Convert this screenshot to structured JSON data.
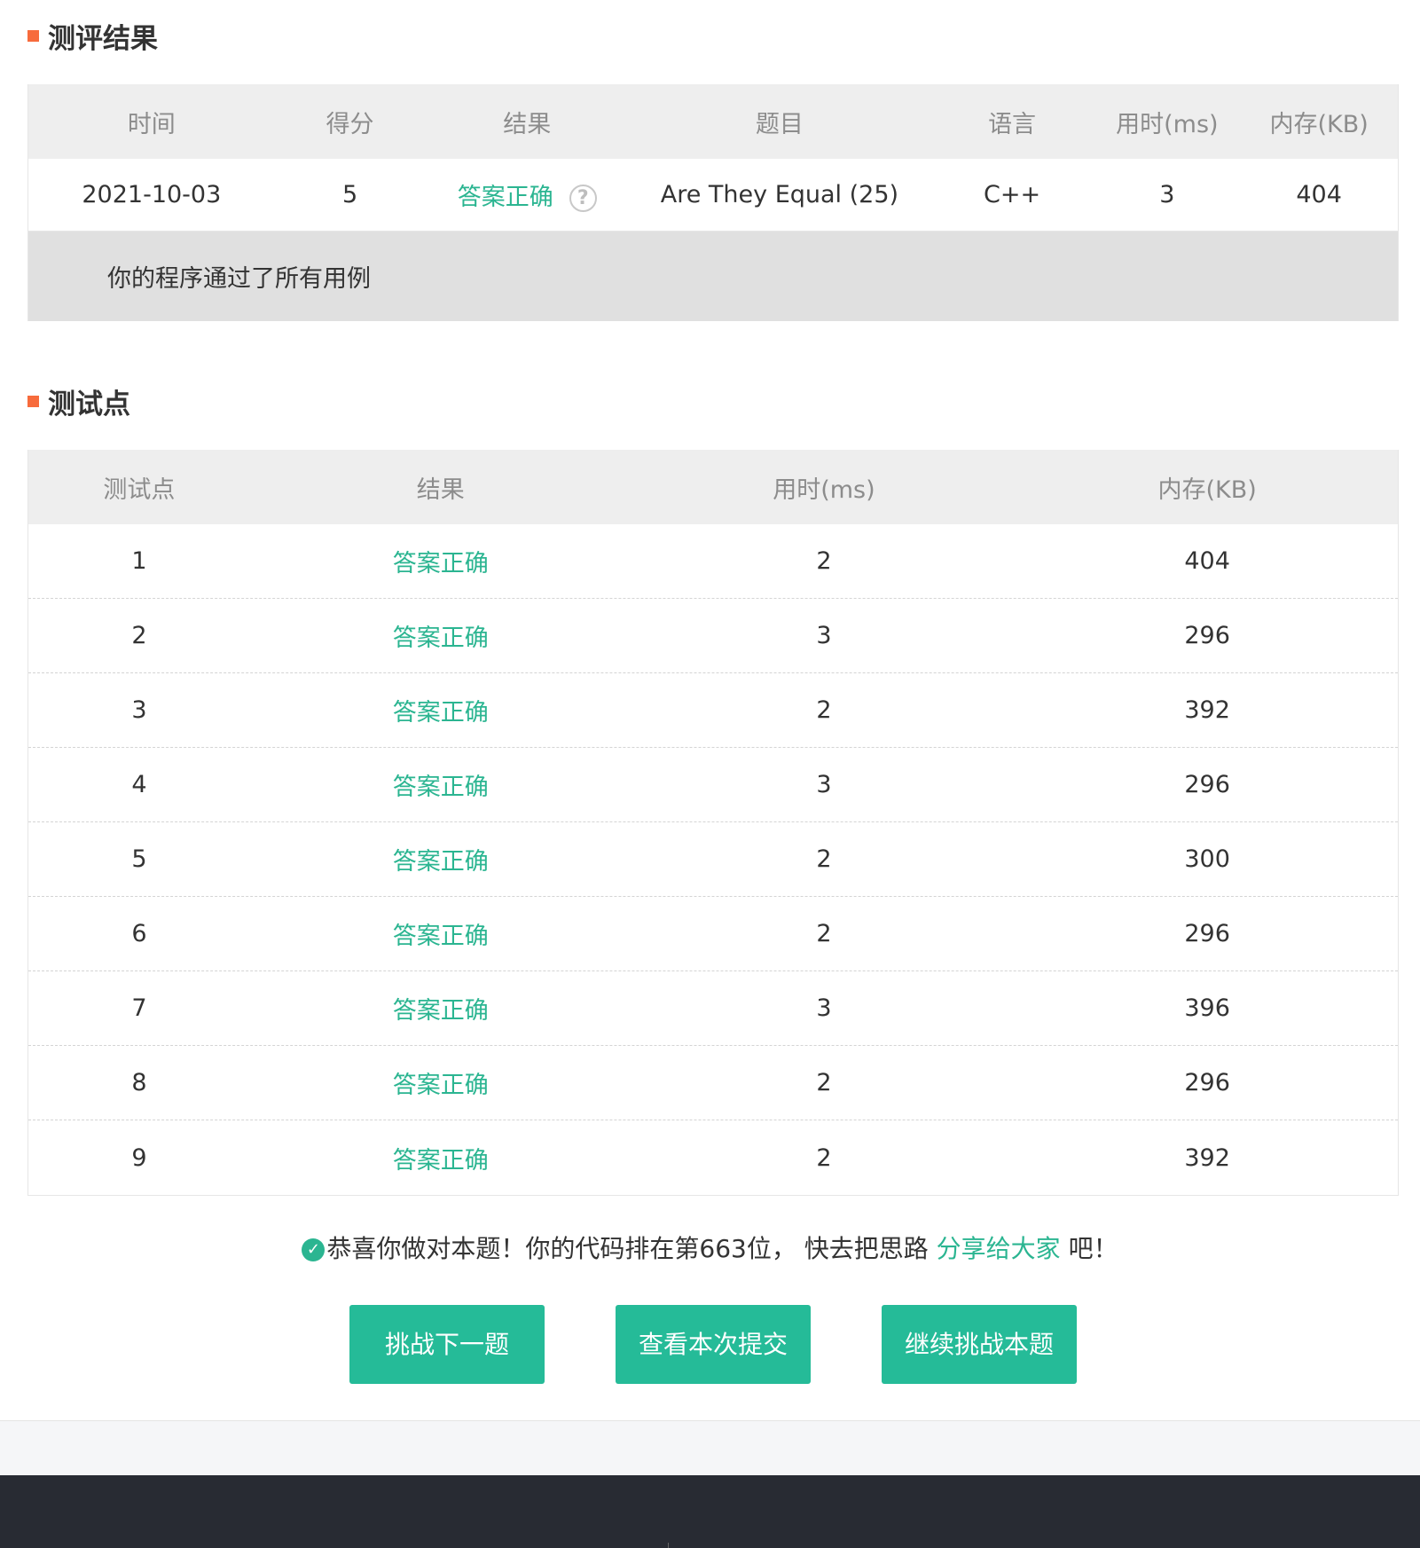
{
  "result_section": {
    "title": "测评结果",
    "headers": [
      "时间",
      "得分",
      "结果",
      "题目",
      "语言",
      "用时(ms)",
      "内存(KB)"
    ],
    "row": {
      "time": "2021-10-03",
      "score": "5",
      "result": "答案正确",
      "problem": "Are They Equal (25)",
      "language": "C++",
      "time_ms": "3",
      "memory_kb": "404"
    },
    "message": "你的程序通过了所有用例"
  },
  "testpoint_section": {
    "title": "测试点",
    "headers": [
      "测试点",
      "结果",
      "用时(ms)",
      "内存(KB)"
    ],
    "rows": [
      {
        "id": "1",
        "result": "答案正确",
        "time_ms": "2",
        "memory_kb": "404"
      },
      {
        "id": "2",
        "result": "答案正确",
        "time_ms": "3",
        "memory_kb": "296"
      },
      {
        "id": "3",
        "result": "答案正确",
        "time_ms": "2",
        "memory_kb": "392"
      },
      {
        "id": "4",
        "result": "答案正确",
        "time_ms": "3",
        "memory_kb": "296"
      },
      {
        "id": "5",
        "result": "答案正确",
        "time_ms": "2",
        "memory_kb": "300"
      },
      {
        "id": "6",
        "result": "答案正确",
        "time_ms": "2",
        "memory_kb": "296"
      },
      {
        "id": "7",
        "result": "答案正确",
        "time_ms": "3",
        "memory_kb": "396"
      },
      {
        "id": "8",
        "result": "答案正确",
        "time_ms": "2",
        "memory_kb": "296"
      },
      {
        "id": "9",
        "result": "答案正确",
        "time_ms": "2",
        "memory_kb": "392"
      }
    ]
  },
  "congrats": {
    "text": "恭喜你做对本题！你的代码排在第663位， 快去把思路 ",
    "link": "分享给大家",
    "suffix": " 吧！"
  },
  "buttons": {
    "next": "挑战下一题",
    "view_submission": "查看本次提交",
    "retry": "继续挑战本题"
  },
  "icons": {
    "help": "question-mark-circle",
    "check": "check-circle"
  },
  "colors": {
    "accent": "#25bb98",
    "success_text": "#2bb591",
    "section_marker": "#f76b3c",
    "footer": "#282b33"
  }
}
